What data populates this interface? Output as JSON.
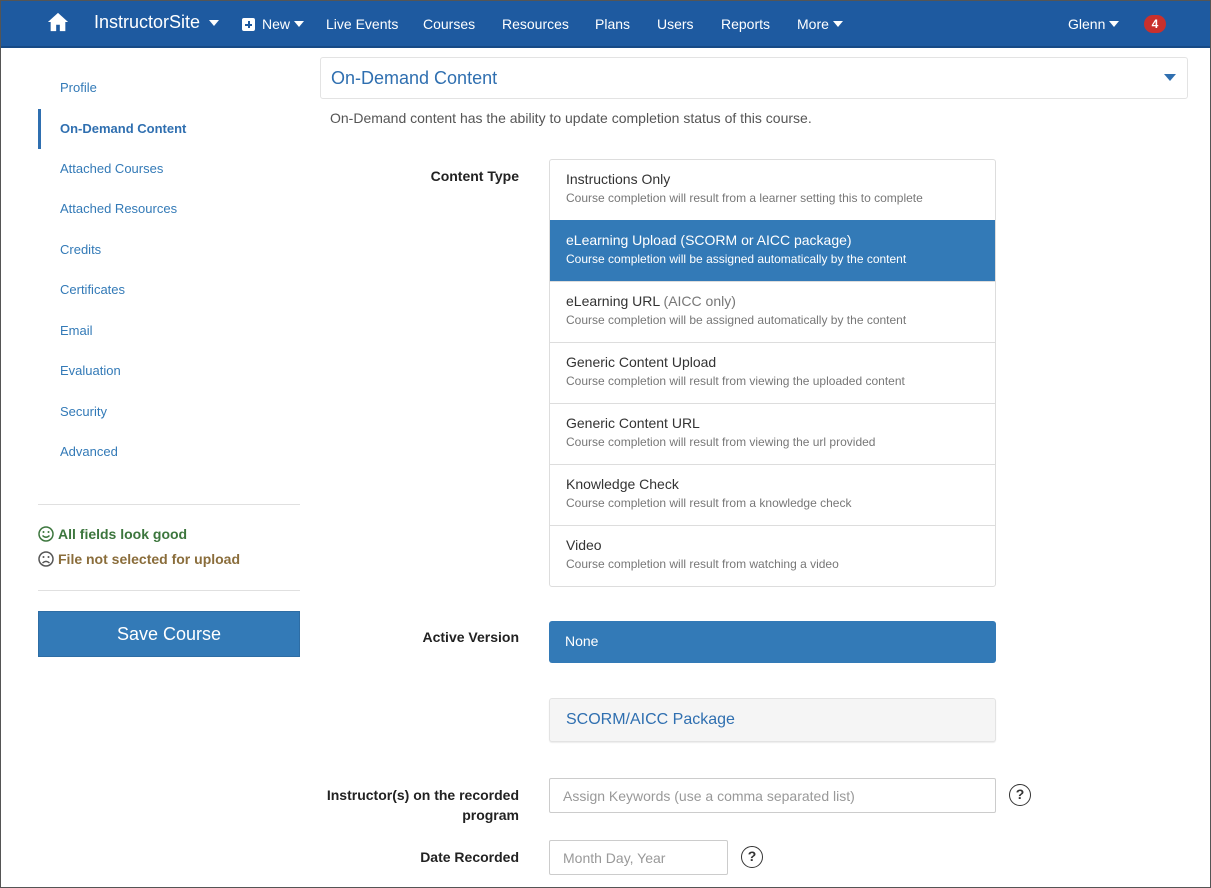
{
  "topnav": {
    "brand": "InstructorSite",
    "new_label": "New",
    "items": [
      "Live Events",
      "Courses",
      "Resources",
      "Plans",
      "Users",
      "Reports"
    ],
    "more_label": "More",
    "user": "Glenn",
    "notifications": "4",
    "icons": {
      "home": "home-icon",
      "new": "plus-square-icon"
    }
  },
  "sidebar": {
    "items": [
      {
        "label": "Profile"
      },
      {
        "label": "On-Demand Content",
        "active": true
      },
      {
        "label": "Attached Courses"
      },
      {
        "label": "Attached Resources"
      },
      {
        "label": "Credits"
      },
      {
        "label": "Certificates"
      },
      {
        "label": "Email"
      },
      {
        "label": "Evaluation"
      },
      {
        "label": "Security"
      },
      {
        "label": "Advanced"
      }
    ],
    "status_good": "All fields look good",
    "status_warn": "File not selected for upload",
    "save_label": "Save Course"
  },
  "main": {
    "panel_title": "On-Demand Content",
    "description": "On-Demand content has the ability to update completion status of this course.",
    "content_type_label": "Content Type",
    "content_types": [
      {
        "title": "Instructions Only",
        "sub": "",
        "desc": "Course completion will result from a learner setting this to complete"
      },
      {
        "title": "eLearning Upload",
        "sub": " (SCORM or AICC package)",
        "desc": "Course completion will be assigned automatically by the content",
        "selected": true
      },
      {
        "title": "eLearning URL",
        "sub": " (AICC only)",
        "desc": "Course completion will be assigned automatically by the content"
      },
      {
        "title": "Generic Content Upload",
        "sub": "",
        "desc": "Course completion will result from viewing the uploaded content"
      },
      {
        "title": "Generic Content URL",
        "sub": "",
        "desc": "Course completion will result from viewing the url provided"
      },
      {
        "title": "Knowledge Check",
        "sub": "",
        "desc": "Course completion will result from a knowledge check"
      },
      {
        "title": "Video",
        "sub": "",
        "desc": "Course completion will result from watching a video"
      }
    ],
    "active_version_label": "Active Version",
    "active_version_value": "None",
    "package_tab": "SCORM/AICC Package",
    "instructors_label_line1": "Instructor(s) on the recorded",
    "instructors_label_line2": "program",
    "instructors_placeholder": "Assign Keywords (use a comma separated list)",
    "date_label": "Date Recorded",
    "date_placeholder": "Month Day, Year",
    "help_glyph": "?"
  },
  "colors": {
    "nav": "#1e5aa0",
    "primary": "#337ab7",
    "good": "#3c763d",
    "warn": "#8a6d3b",
    "badge": "#c9302c"
  }
}
